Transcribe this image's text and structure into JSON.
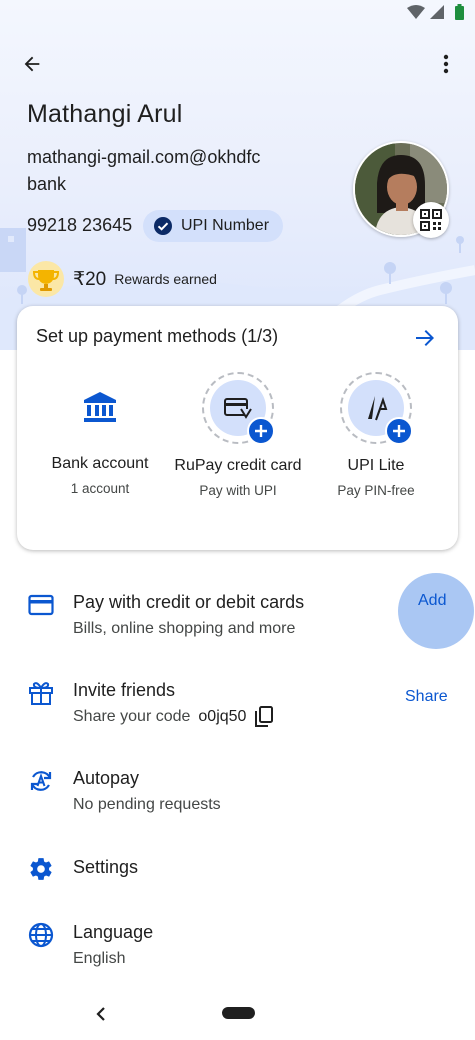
{
  "colors": {
    "accent": "#0b57d0",
    "chip_bg": "#d3e0fb",
    "gold": "#f4b400"
  },
  "status_bar": {
    "icons": [
      "wifi-icon",
      "cellular-icon",
      "battery-icon"
    ]
  },
  "header": {
    "back_icon": "arrow-back-icon",
    "menu_icon": "more-vert-icon"
  },
  "profile": {
    "name": "Mathangi Arul",
    "upi_id_line1": "mathangi-gmail.com@okhdfc",
    "upi_id_line2": "bank",
    "phone": "99218 23645",
    "upi_number_label": "UPI Number"
  },
  "rewards": {
    "amount": "₹20",
    "label": "Rewards earned"
  },
  "payment_methods": {
    "title": "Set up payment methods (1/3)",
    "items": [
      {
        "title": "Bank account",
        "subtitle": "1 account",
        "icon": "bank-icon"
      },
      {
        "title": "RuPay credit card",
        "subtitle": "Pay with UPI",
        "icon": "credit-card-icon"
      },
      {
        "title": "UPI Lite",
        "subtitle": "Pay PIN-free",
        "icon": "upi-lite-icon"
      }
    ]
  },
  "list": [
    {
      "title": "Pay with credit or debit cards",
      "subtitle": "Bills, online shopping and more",
      "action": "Add",
      "icon": "credit-card-icon"
    },
    {
      "title": "Invite friends",
      "subtitle": "Share your code",
      "code": "o0jq50",
      "action": "Share",
      "icon": "gift-icon"
    },
    {
      "title": "Autopay",
      "subtitle": "No pending requests",
      "icon": "autopay-icon"
    },
    {
      "title": "Settings",
      "icon": "gear-icon"
    },
    {
      "title": "Language",
      "subtitle": "English",
      "icon": "globe-icon"
    }
  ],
  "nav": {
    "back": "nav-back-icon",
    "home": "nav-home-pill"
  }
}
